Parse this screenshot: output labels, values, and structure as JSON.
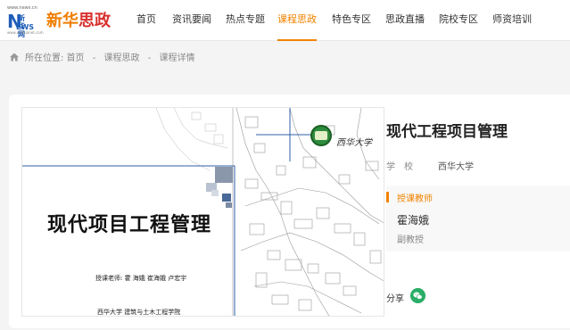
{
  "header": {
    "logo": {
      "small_url": "www.news.cn",
      "news_letter": "N",
      "news_cn": "新华网",
      "news_rest": "EWS",
      "sub_url": "www.xinhuanet.com",
      "title_part1": "新华",
      "title_part2": "思政"
    },
    "nav": [
      "首页",
      "资讯要闻",
      "热点专题",
      "课程思政",
      "特色专区",
      "思政直播",
      "院校专区",
      "师资培训"
    ],
    "active_index": 3,
    "accent_color": "#f08300"
  },
  "breadcrumb": {
    "prefix": "所在位置:",
    "items": [
      "首页",
      "课程思政",
      "课程详情"
    ],
    "separator": "-"
  },
  "course": {
    "cover": {
      "title": "现代项目工程管理",
      "teachers": "授课老师:  霍  海娥  崔海娥  卢宏宇",
      "school": "西华大学  建筑与土木工程学院",
      "university": "西华大学"
    },
    "title": "现代工程项目管理",
    "school_label": "学校",
    "school_value": "西华大学",
    "teacher_heading": "授课教师",
    "teacher_name": "霍海娥",
    "teacher_title": "副教授",
    "share_label": "分享",
    "share_icon": "wechat-icon"
  }
}
